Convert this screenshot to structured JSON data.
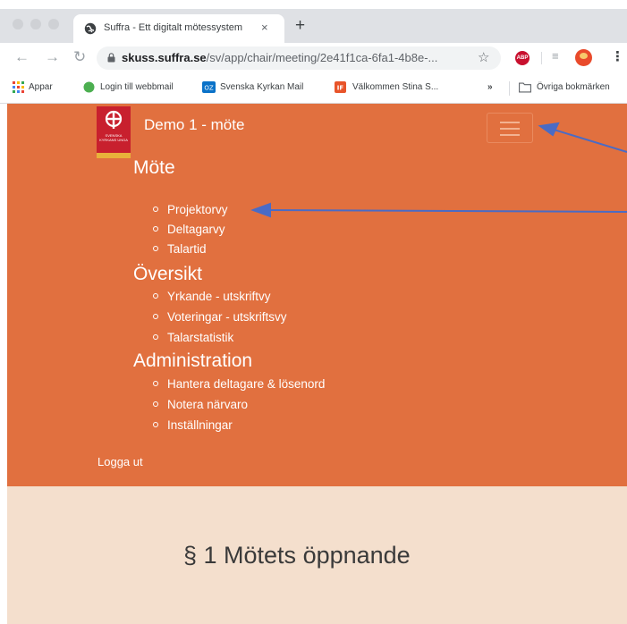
{
  "browser": {
    "tab_title": "Suffra - Ett digitalt mötessystem",
    "tab_close": "×",
    "new_tab": "+",
    "url_host": "skuss.suffra.se",
    "url_path": "/sv/app/chair/meeting/2e41f1ca-6fa1-4b8e-...",
    "ext_abp": "ABP",
    "bookmarks": [
      {
        "label": "Appar"
      },
      {
        "label": "Login till webbmail"
      },
      {
        "label": "Svenska Kyrkan Mail"
      },
      {
        "label": "Välkommen Stina S..."
      },
      {
        "label": "»"
      },
      {
        "label": "Övriga bokmärken"
      }
    ]
  },
  "header": {
    "title": "Demo 1 - möte",
    "logo_text": "SVENSKA KYRKANS UNGA"
  },
  "nav": {
    "sections": [
      {
        "heading": "Möte",
        "items": [
          "Projektorvy",
          "Deltagarvy",
          "Talartid"
        ]
      },
      {
        "heading": "Översikt",
        "items": [
          "Yrkande - utskriftvy",
          "Voteringar - utskriftsvy",
          "Talarstatistik"
        ]
      },
      {
        "heading": "Administration",
        "items": [
          "Hantera deltagare & lösenord",
          "Notera närvaro",
          "Inställningar"
        ]
      }
    ],
    "logout": "Logga ut"
  },
  "content": {
    "section_title": "§ 1 Mötets öppnande"
  },
  "colors": {
    "brand_orange": "#e1703f",
    "content_bg": "#f4dfcd",
    "arrow": "#4a6bc5"
  }
}
